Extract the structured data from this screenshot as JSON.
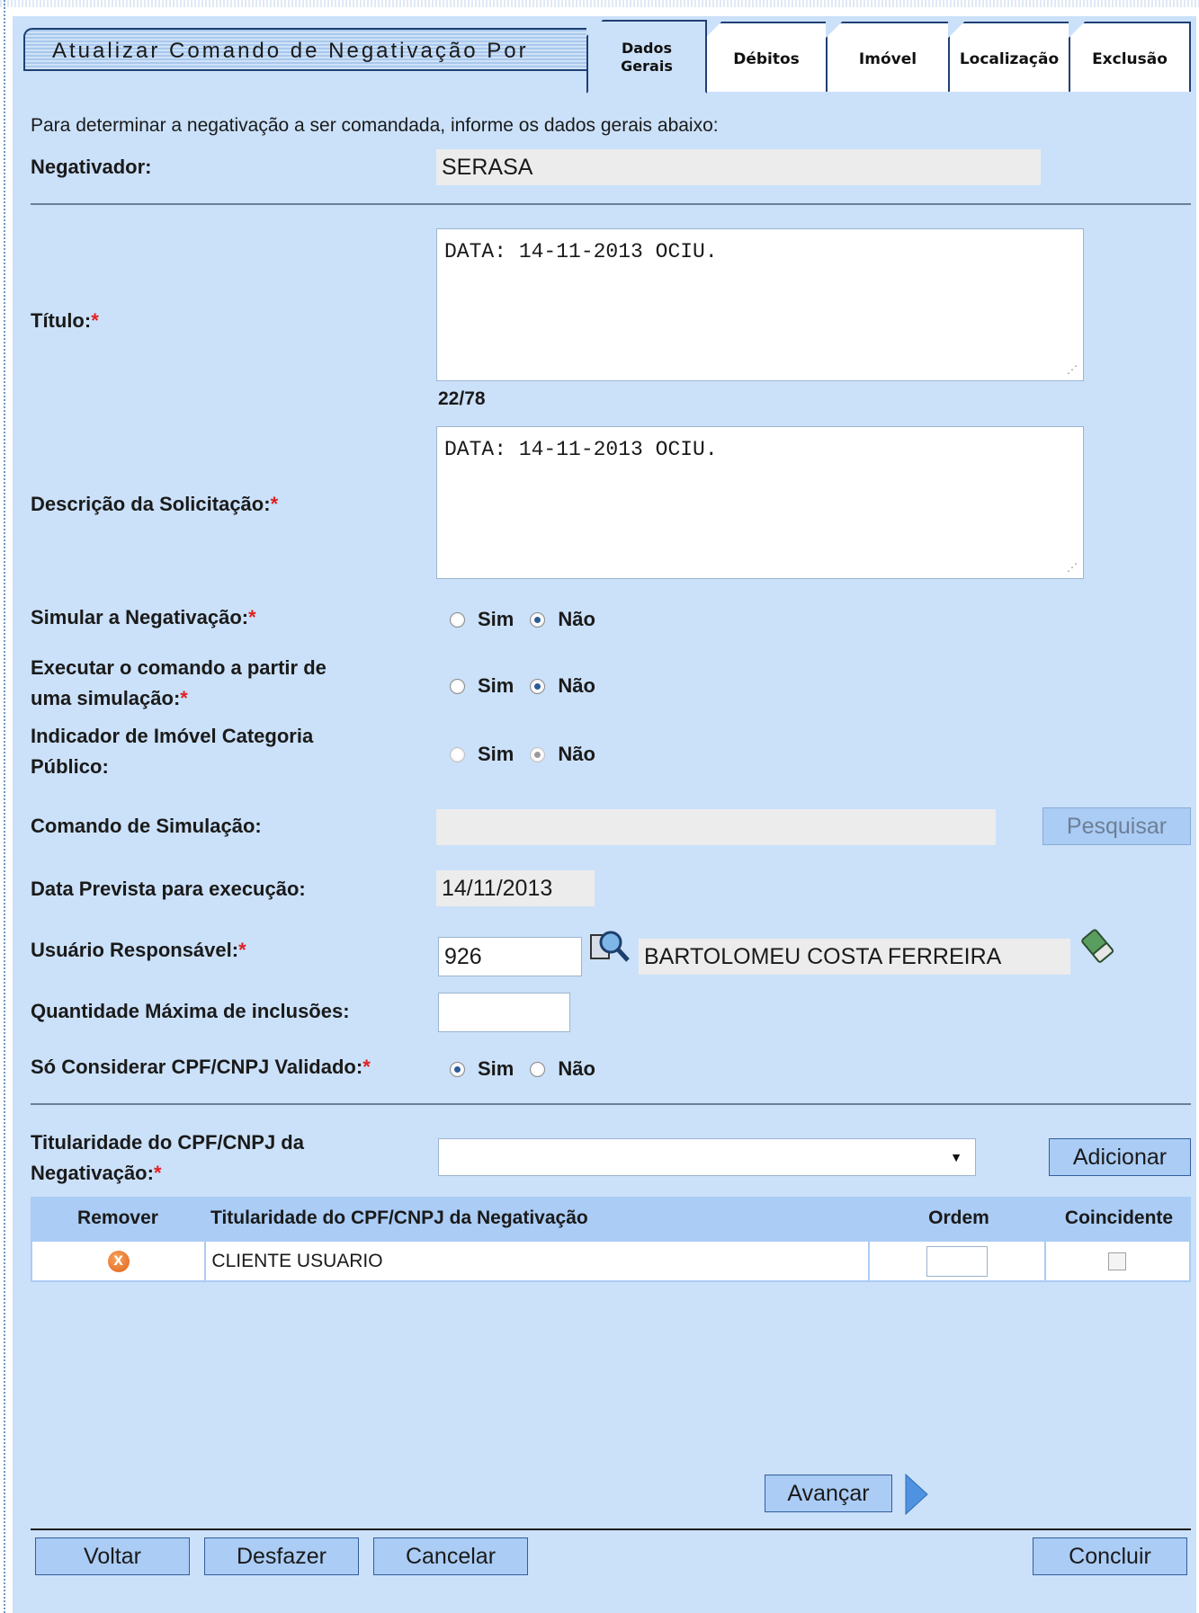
{
  "header": {
    "title": "Atualizar Comando de Negativação Por",
    "tabs": [
      {
        "line1": "Dados",
        "line2": "Gerais"
      },
      {
        "line1": "Débitos",
        "line2": ""
      },
      {
        "line1": "Imóvel",
        "line2": ""
      },
      {
        "line1": "Localização",
        "line2": ""
      },
      {
        "line1": "Exclusão",
        "line2": ""
      }
    ]
  },
  "form": {
    "intro": "Para determinar a negativação a ser comandada, informe os dados gerais abaixo:",
    "negativador": {
      "label": "Negativador:",
      "value": "SERASA"
    },
    "titulo": {
      "label": "Título:",
      "required": "*",
      "value": "DATA: 14-11-2013 OCIU.",
      "counter": "22/78"
    },
    "descricao": {
      "label": "Descrição da Solicitação:",
      "required": "*",
      "value": "DATA: 14-11-2013 OCIU."
    },
    "simular": {
      "label": "Simular a Negativação:",
      "required": "*",
      "sim": "Sim",
      "nao": "Não",
      "selected": "Não"
    },
    "executar": {
      "label_line1": "Executar o comando a partir de",
      "label_line2": "uma simulação:",
      "required": "*",
      "sim": "Sim",
      "nao": "Não",
      "selected": "Não"
    },
    "indicador": {
      "label_line1": "Indicador de Imóvel Categoria",
      "label_line2": "Público:",
      "sim": "Sim",
      "nao": "Não",
      "selected": "Não",
      "disabled": true
    },
    "comando_simulacao": {
      "label": "Comando de Simulação:",
      "value": "",
      "button": "Pesquisar"
    },
    "data_prevista": {
      "label": "Data Prevista para execução:",
      "value": "14/11/2013"
    },
    "usuario": {
      "label": "Usuário Responsável:",
      "required": "*",
      "code": "926",
      "name": "BARTOLOMEU COSTA FERREIRA"
    },
    "quantidade": {
      "label": "Quantidade Máxima de inclusões:",
      "value": ""
    },
    "cpf_validado": {
      "label": "Só Considerar CPF/CNPJ Validado:",
      "required": "*",
      "sim": "Sim",
      "nao": "Não",
      "selected": "Sim"
    },
    "titularidade": {
      "label_line1": "Titularidade do CPF/CNPJ da",
      "label_line2": "Negativação:",
      "required": "*",
      "selected": "",
      "button": "Adicionar"
    }
  },
  "table": {
    "headers": [
      "Remover",
      "Titularidade do CPF/CNPJ da Negativação",
      "Ordem",
      "Coincidente"
    ],
    "rows": [
      {
        "remove_icon": "X",
        "titularidade": "CLIENTE USUARIO",
        "ordem": "",
        "coincidente": false
      }
    ]
  },
  "actions": {
    "avancar": "Avançar",
    "voltar": "Voltar",
    "desfazer": "Desfazer",
    "cancelar": "Cancelar",
    "concluir": "Concluir"
  },
  "icons": {
    "search": "magnifier-icon",
    "clear": "eraser-icon",
    "arrow": "arrow-right-icon"
  }
}
